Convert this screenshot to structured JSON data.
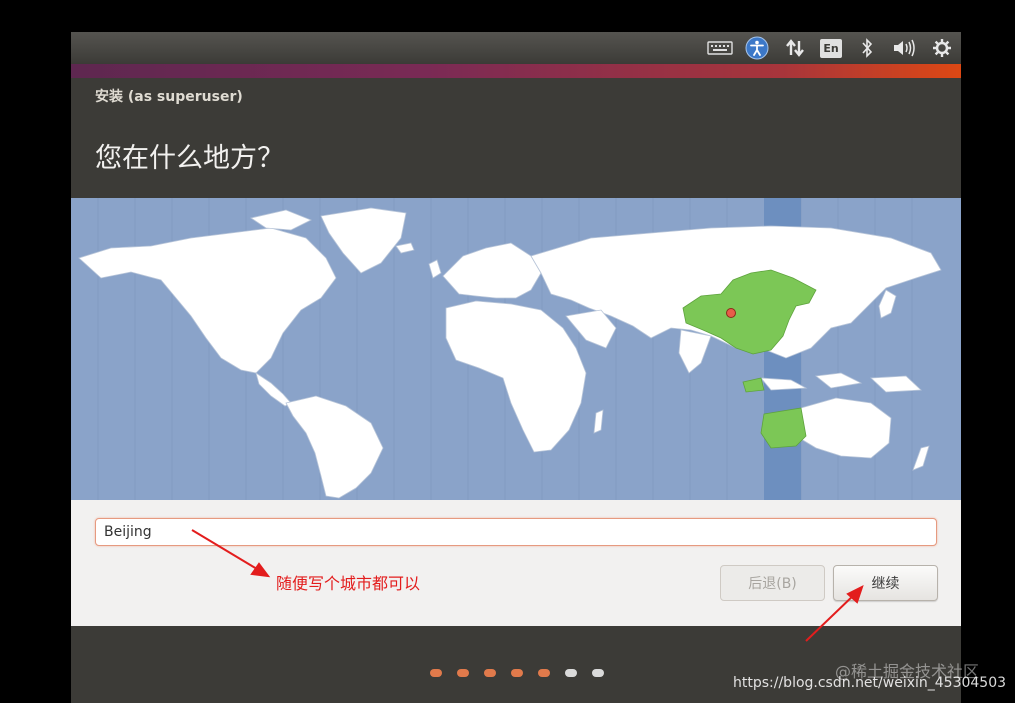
{
  "topbar": {
    "icons": [
      "keyboard-icon",
      "accessibility-icon",
      "network-icon",
      "keyboard-layout-indicator",
      "bluetooth-icon",
      "volume-icon",
      "settings-gear-icon"
    ],
    "keyboard_layout": "En",
    "accessibility_color": "#3c78c8"
  },
  "window": {
    "title": "安装 (as superuser)"
  },
  "page": {
    "title": "您在什么地方？"
  },
  "map": {
    "ocean_color": "#8aa3c9",
    "land_color": "#ffffff",
    "selected_region_color": "#7cc756",
    "selected_timezone_band_color": "#6d8fbf",
    "selected_marker_color": "#e85d4a"
  },
  "location": {
    "value": "Beijing"
  },
  "annotation": {
    "text": "随便写个城市都可以",
    "color": "#e31d1d"
  },
  "buttons": {
    "back": "后退(B)",
    "continue": "继续"
  },
  "progress": {
    "total_steps": 7,
    "completed_steps": 5,
    "done_color": "#e17a4b",
    "pending_color": "#dadada"
  },
  "watermarks": [
    "@稀土掘金技术社区",
    "https://blog.csdn.net/weixin_45304503"
  ]
}
